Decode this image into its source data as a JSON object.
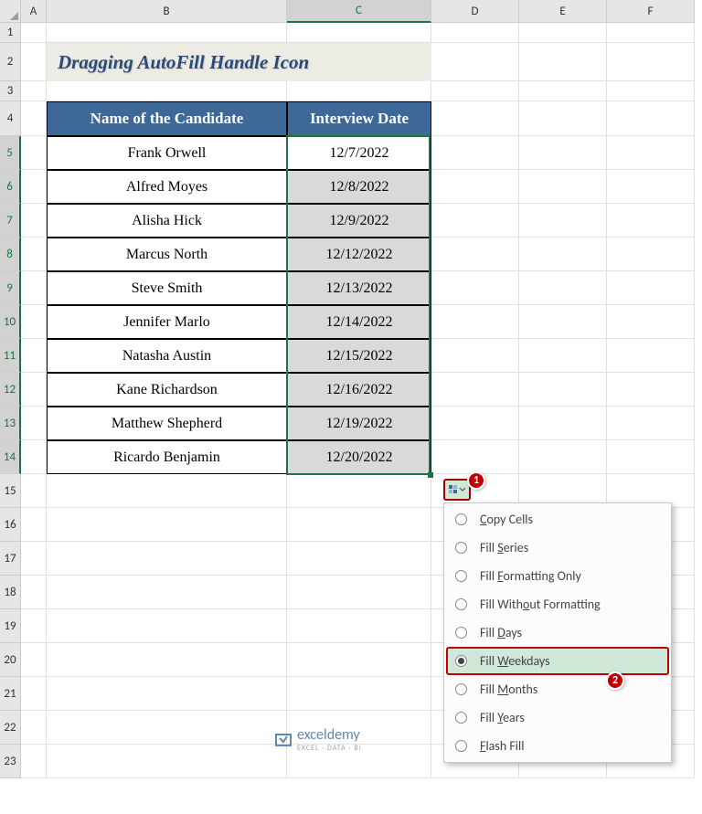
{
  "columns": [
    "A",
    "B",
    "C",
    "D",
    "E",
    "F"
  ],
  "rows": [
    "1",
    "2",
    "3",
    "4",
    "5",
    "6",
    "7",
    "8",
    "9",
    "10",
    "11",
    "12",
    "13",
    "14",
    "15",
    "16",
    "17",
    "18",
    "19",
    "20",
    "21",
    "22",
    "23"
  ],
  "title": "Dragging AutoFill Handle Icon",
  "headers": {
    "b": "Name of the Candidate",
    "c": "Interview Date"
  },
  "data": [
    {
      "name": "Frank Orwell",
      "date": "12/7/2022"
    },
    {
      "name": "Alfred Moyes",
      "date": "12/8/2022"
    },
    {
      "name": "Alisha Hick",
      "date": "12/9/2022"
    },
    {
      "name": "Marcus North",
      "date": "12/12/2022"
    },
    {
      "name": "Steve Smith",
      "date": "12/13/2022"
    },
    {
      "name": "Jennifer Marlo",
      "date": "12/14/2022"
    },
    {
      "name": "Natasha Austin",
      "date": "12/15/2022"
    },
    {
      "name": "Kane Richardson",
      "date": "12/16/2022"
    },
    {
      "name": "Matthew Shepherd",
      "date": "12/19/2022"
    },
    {
      "name": "Ricardo Benjamin",
      "date": "12/20/2022"
    }
  ],
  "callouts": {
    "one": "1",
    "two": "2"
  },
  "menu": {
    "copy_cells": {
      "pre": "",
      "u": "C",
      "post": "opy Cells"
    },
    "fill_series": {
      "pre": "Fill ",
      "u": "S",
      "post": "eries"
    },
    "fill_formatting": {
      "pre": "Fill ",
      "u": "F",
      "post": "ormatting Only"
    },
    "fill_without_fmt": {
      "pre": "Fill With",
      "u": "o",
      "post": "ut Formatting"
    },
    "fill_days": {
      "pre": "Fill ",
      "u": "D",
      "post": "ays"
    },
    "fill_weekdays": {
      "pre": "Fill ",
      "u": "W",
      "post": "eekdays"
    },
    "fill_months": {
      "pre": "Fill ",
      "u": "M",
      "post": "onths"
    },
    "fill_years": {
      "pre": "Fill ",
      "u": "Y",
      "post": "ears"
    },
    "flash_fill": {
      "pre": "",
      "u": "F",
      "post": "lash Fill"
    }
  },
  "watermark": {
    "brand": "exceldemy",
    "sub": "EXCEL · DATA · BI"
  }
}
